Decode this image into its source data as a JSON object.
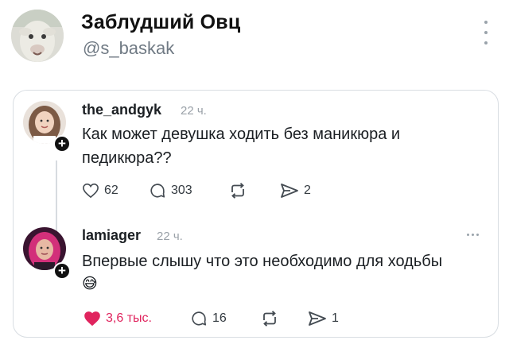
{
  "profile": {
    "name": "Заблудший Овц",
    "handle": "@s_baskak"
  },
  "posts": [
    {
      "username": "the_andgyk",
      "time": "22 ч.",
      "text": "Как может девушка ходить без маникюра и педикюра??",
      "likes": "62",
      "comments": "303",
      "shares": "2",
      "liked": false
    },
    {
      "username": "lamiager",
      "time": "22 ч.",
      "text": "Впервые слышу что это необходимо для ходьбы",
      "likes": "3,6 тыс.",
      "comments": "16",
      "shares": "1",
      "liked": true,
      "emoji": "😅"
    }
  ],
  "icons": {
    "heart": "heart-icon",
    "comment": "comment-icon",
    "repost": "repost-icon",
    "share": "share-icon",
    "more": "more-icon",
    "follow": "plus-icon"
  },
  "colors": {
    "liked": "#e0245e",
    "muted": "#9aa1a8",
    "border": "#d8dde2"
  }
}
